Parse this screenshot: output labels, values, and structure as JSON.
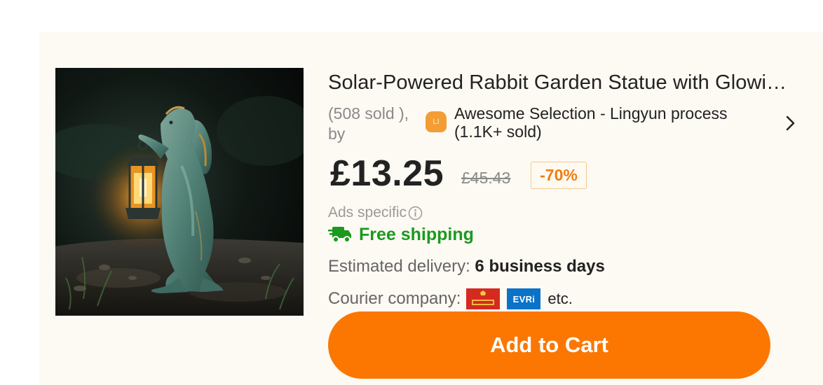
{
  "product": {
    "title": "Solar-Powered Rabbit Garden Statue with Glowi…",
    "image_alt": "rabbit-statue-with-lantern",
    "sold_by": "(508 sold ), by",
    "store": {
      "badge": "LI",
      "name": "Awesome Selection - Lingyun process (1.1K+ sold)"
    }
  },
  "pricing": {
    "price": "£13.25",
    "original_price": "£45.43",
    "discount": "-70%"
  },
  "ads": {
    "label": "Ads specific"
  },
  "shipping": {
    "icon": "truck-icon",
    "label": "Free shipping",
    "delivery_label": "Estimated delivery:",
    "delivery_value": "6 business days",
    "courier_label": "Courier company:",
    "courier_logos": [
      "Royal Mail",
      "EVRi"
    ],
    "etc": "etc."
  },
  "actions": {
    "add_to_cart": "Add to Cart"
  },
  "colors": {
    "accent": "#fb7701",
    "shipping_green": "#1a9a1f",
    "card_bg": "#fdf9f3"
  }
}
